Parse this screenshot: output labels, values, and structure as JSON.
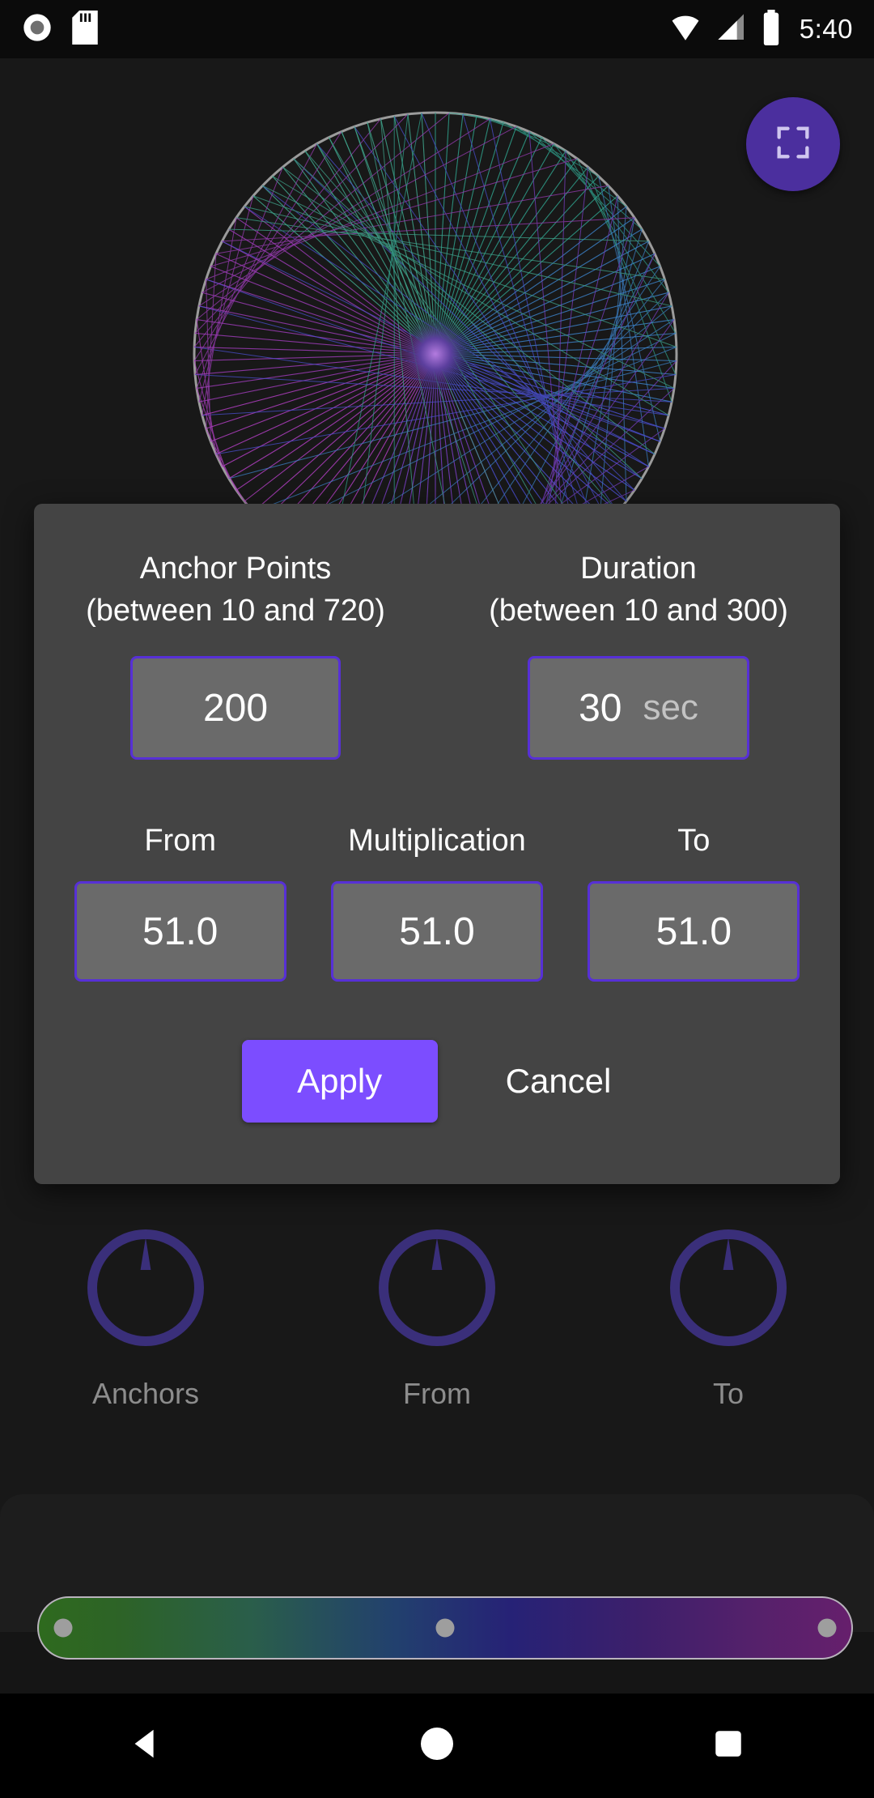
{
  "status_bar": {
    "icons_left": [
      "record-circle-icon",
      "sd-card-icon"
    ],
    "icons_right": [
      "wifi-icon",
      "cell-signal-icon",
      "battery-icon"
    ],
    "clock": "5:40"
  },
  "canvas": {
    "fab_icon": "fullscreen-icon"
  },
  "dialog": {
    "anchor_points": {
      "label_line1": "Anchor Points",
      "label_line2": "(between 10 and 720)",
      "value": "200"
    },
    "duration": {
      "label_line1": "Duration",
      "label_line2": "(between 10 and 300)",
      "value": "30",
      "unit": "sec"
    },
    "from": {
      "label": "From",
      "value": "51.0"
    },
    "multiplication": {
      "label": "Multiplication",
      "value": "51.0"
    },
    "to": {
      "label": "To",
      "value": "51.0"
    },
    "apply_label": "Apply",
    "cancel_label": "Cancel",
    "accent_color": "#5730d6",
    "apply_color": "#7c4dff",
    "surface_color": "#444444"
  },
  "knobs": [
    {
      "label": "Anchors",
      "icon": "knob-dial-icon"
    },
    {
      "label": "From",
      "icon": "knob-dial-icon"
    },
    {
      "label": "To",
      "icon": "knob-dial-icon"
    }
  ],
  "palette": {
    "stops": [
      "#2e6a1e",
      "#22406e",
      "#661f6c"
    ],
    "handles": [
      3,
      50,
      97
    ]
  },
  "nav_bar": {
    "back_icon": "triangle-back-icon",
    "home_icon": "circle-home-icon",
    "recents_icon": "square-recents-icon"
  }
}
